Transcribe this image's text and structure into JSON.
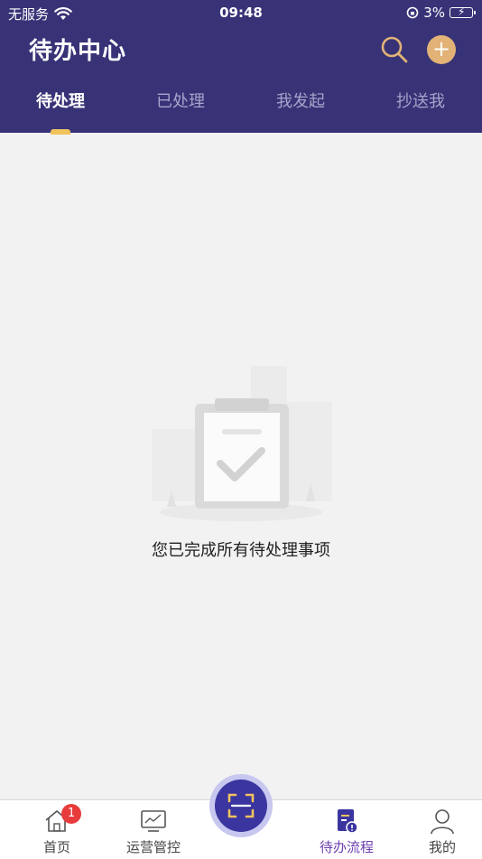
{
  "status": {
    "carrier": "无服务",
    "time": "09:48",
    "battery": "3%"
  },
  "header": {
    "title": "待办中心",
    "search_icon": "search-icon",
    "add_icon": "plus-icon",
    "add_label": "+"
  },
  "tabs": [
    {
      "label": "待处理",
      "active": true
    },
    {
      "label": "已处理",
      "active": false
    },
    {
      "label": "我发起",
      "active": false
    },
    {
      "label": "抄送我",
      "active": false
    }
  ],
  "empty": {
    "message": "您已完成所有待处理事项",
    "icon": "clipboard-check-illustration"
  },
  "tabbar": {
    "items": [
      {
        "label": "首页",
        "icon": "home-icon",
        "badge": "1"
      },
      {
        "label": "运营管控",
        "icon": "monitor-chart-icon"
      },
      {
        "label": "",
        "icon": "scan-icon"
      },
      {
        "label": "待办流程",
        "icon": "todo-document-icon",
        "active": true
      },
      {
        "label": "我的",
        "icon": "user-icon"
      }
    ]
  },
  "colors": {
    "header_bg": "#383377",
    "accent_gold": "#f0c35c",
    "add_button": "#e2b276",
    "badge_red": "#e83b3b",
    "active_tab_label": "#6d3fb0",
    "scan_button": "#3b35a0"
  }
}
